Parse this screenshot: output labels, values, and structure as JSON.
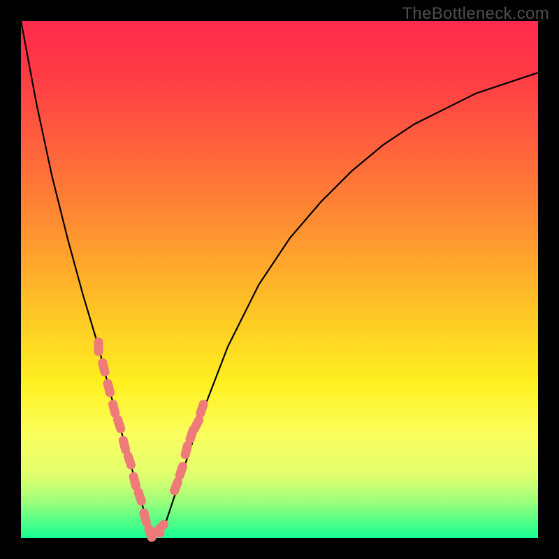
{
  "watermark": "TheBottleneck.com",
  "colors": {
    "frame_background": "#000000",
    "gradient_top": "#ff2a4d",
    "gradient_bottom": "#18ff94",
    "curve_stroke": "#000000",
    "marker_fill": "#ef7a7a",
    "watermark_text": "#4e4e4e"
  },
  "chart_data": {
    "type": "line",
    "title": "",
    "xlabel": "",
    "ylabel": "",
    "xlim": [
      0,
      100
    ],
    "ylim": [
      0,
      100
    ],
    "x": [
      0,
      3,
      6,
      9,
      12,
      15,
      17,
      19,
      21,
      23,
      25,
      28,
      31,
      35,
      40,
      46,
      52,
      58,
      64,
      70,
      76,
      82,
      88,
      94,
      100
    ],
    "series": [
      {
        "name": "bottleneck_curve",
        "values": [
          100,
          84,
          70,
          58,
          47,
          37,
          29,
          22,
          15,
          8,
          1,
          3,
          12,
          24,
          37,
          49,
          58,
          65,
          71,
          76,
          80,
          83,
          86,
          88,
          90
        ]
      }
    ],
    "markers": {
      "name": "highlighted_segments",
      "shape": "rounded_bar",
      "x": [
        15,
        16,
        17,
        18,
        19,
        20,
        21,
        22,
        23,
        24,
        25,
        26,
        27,
        30,
        31,
        32,
        33,
        34,
        35
      ],
      "y": [
        37,
        33,
        29,
        25,
        22,
        18,
        15,
        11,
        8,
        4,
        1,
        1,
        2,
        10,
        13,
        17,
        20,
        22,
        25
      ]
    },
    "notes": "Axes are unlabeled in the source image; x and y are normalized 0–100. Curve values are estimated from pixel positions against the plot bounds."
  }
}
